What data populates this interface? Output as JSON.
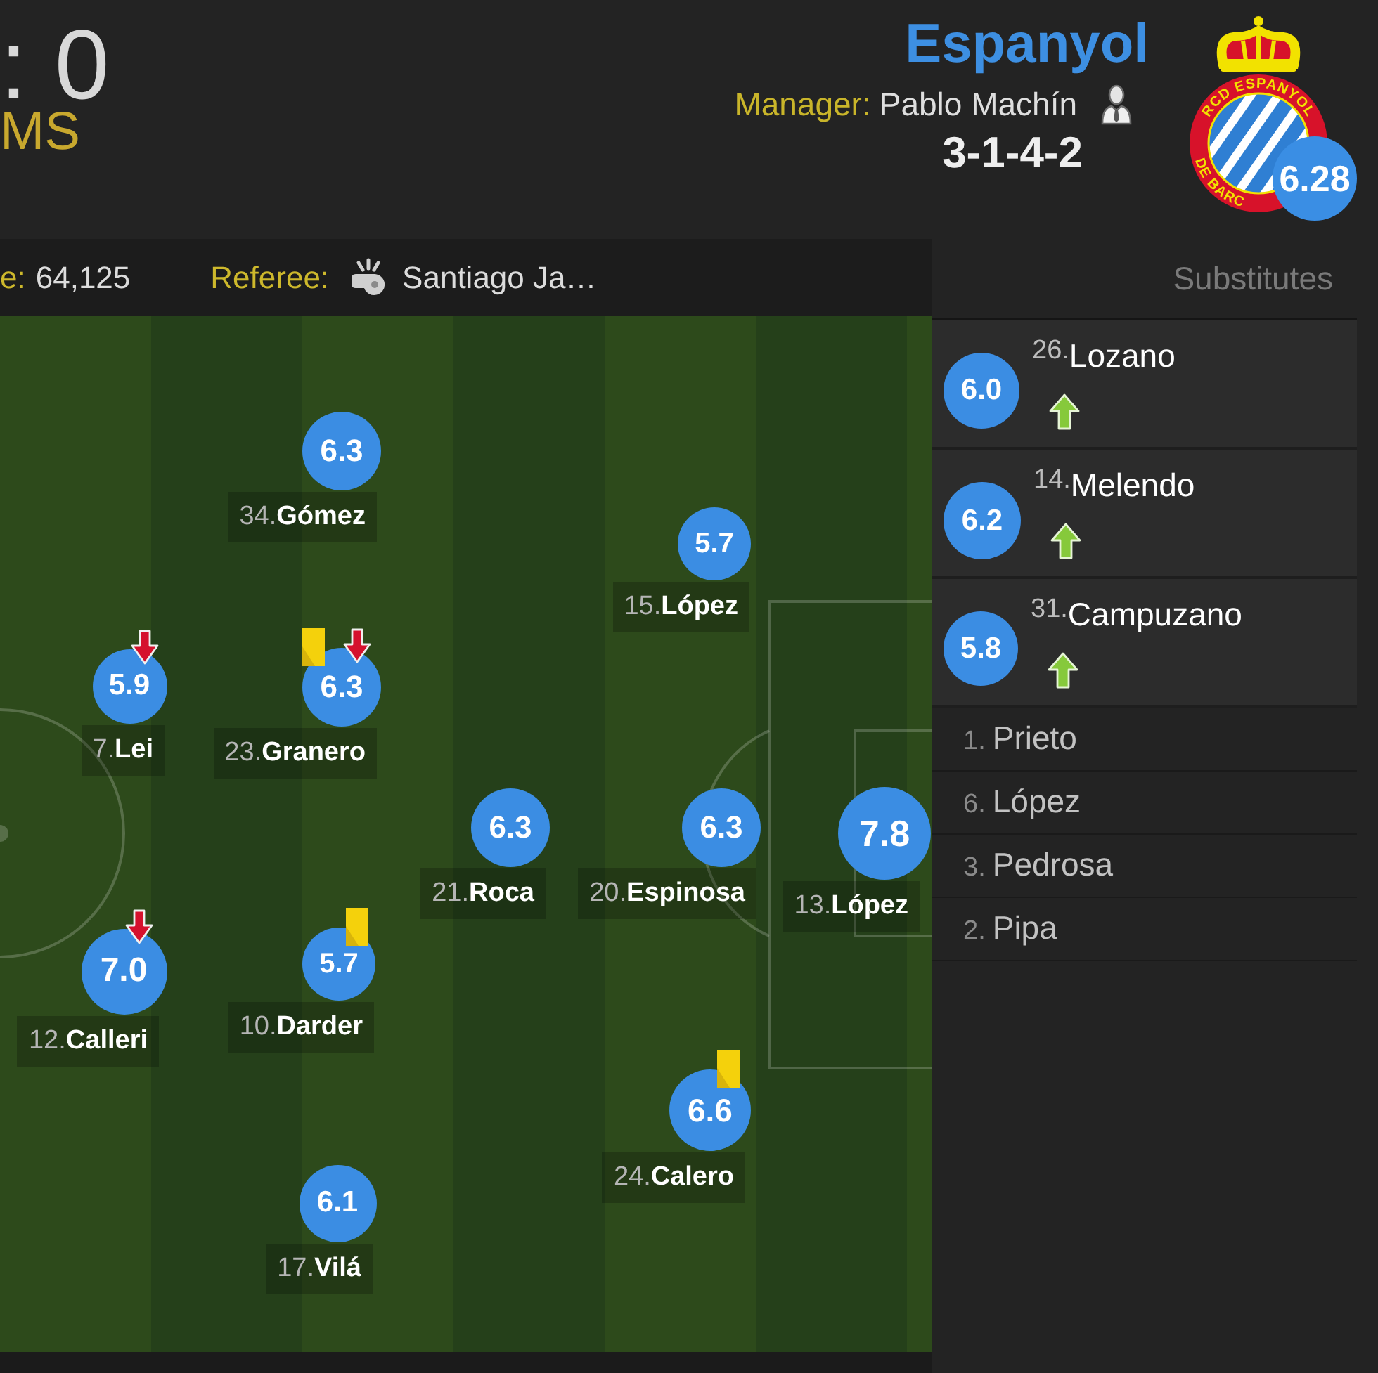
{
  "scoreboard": {
    "score": ": 0",
    "caption": "MS"
  },
  "team": {
    "name": "Espanyol",
    "manager_label": "Manager:",
    "manager": "Pablo Machín",
    "formation": "3-1-4-2",
    "crest_text_top": "RCD ESPANYOL",
    "crest_text_bottom": "DE BARC",
    "average_rating": "6.28"
  },
  "match_info": {
    "attendance_label": "e:",
    "attendance": "64,125",
    "referee_label": "Referee:",
    "referee": "Santiago Ja…"
  },
  "pitch": {
    "players": [
      {
        "number": "34.",
        "name": "Gómez",
        "rating": "6.3",
        "yellow_card": false,
        "subbed_off": false
      },
      {
        "number": "15.",
        "name": "López",
        "rating": "5.7",
        "yellow_card": false,
        "subbed_off": false
      },
      {
        "number": "7.",
        "name": "Lei",
        "rating": "5.9",
        "yellow_card": false,
        "subbed_off": true
      },
      {
        "number": "23.",
        "name": "Granero",
        "rating": "6.3",
        "yellow_card": true,
        "subbed_off": true
      },
      {
        "number": "21.",
        "name": "Roca",
        "rating": "6.3",
        "yellow_card": false,
        "subbed_off": false
      },
      {
        "number": "20.",
        "name": "Espinosa",
        "rating": "6.3",
        "yellow_card": false,
        "subbed_off": false
      },
      {
        "number": "13.",
        "name": "López",
        "rating": "7.8",
        "yellow_card": false,
        "subbed_off": false
      },
      {
        "number": "12.",
        "name": "Calleri",
        "rating": "7.0",
        "yellow_card": false,
        "subbed_off": true
      },
      {
        "number": "10.",
        "name": "Darder",
        "rating": "5.7",
        "yellow_card": true,
        "subbed_off": false
      },
      {
        "number": "24.",
        "name": "Calero",
        "rating": "6.6",
        "yellow_card": true,
        "subbed_off": false
      },
      {
        "number": "17.",
        "name": "Vilá",
        "rating": "6.1",
        "yellow_card": false,
        "subbed_off": false
      }
    ]
  },
  "substitutes": {
    "title": "Substitutes",
    "players": [
      {
        "kind": "used",
        "number": "26.",
        "name": "Lozano",
        "rating": "6.0",
        "subbed_on": true
      },
      {
        "kind": "used",
        "number": "14.",
        "name": "Melendo",
        "rating": "6.2",
        "subbed_on": true
      },
      {
        "kind": "used",
        "number": "31.",
        "name": "Campuzano",
        "rating": "5.8",
        "subbed_on": true
      },
      {
        "kind": "unused",
        "number": "1.",
        "name": "Prieto",
        "subbed_on": false
      },
      {
        "kind": "unused",
        "number": "6.",
        "name": "López",
        "subbed_on": false
      },
      {
        "kind": "unused",
        "number": "3.",
        "name": "Pedrosa",
        "subbed_on": false
      },
      {
        "kind": "unused",
        "number": "2.",
        "name": "Pipa",
        "subbed_on": false
      }
    ]
  }
}
